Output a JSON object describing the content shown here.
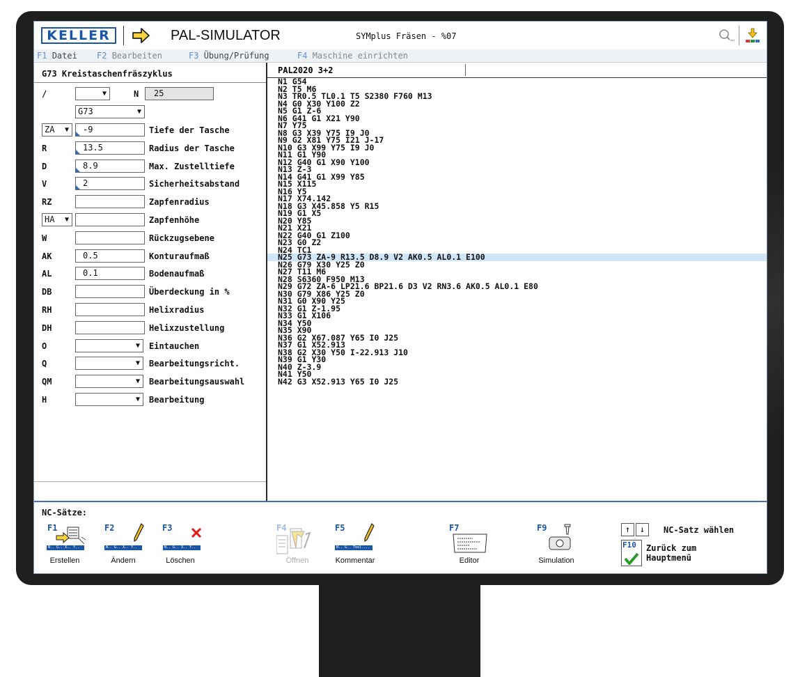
{
  "titlebar": {
    "logo": "KELLER",
    "app_title": "PAL-SIMULATOR",
    "program_title": "SYMplus Fräsen - %07",
    "icons": [
      "arrow-right-icon",
      "search-icon",
      "tool-icon"
    ]
  },
  "menu": [
    {
      "key": "F1",
      "label": "Datei"
    },
    {
      "key": "F2",
      "label": "Bearbeiten"
    },
    {
      "key": "F3",
      "label": "Übung/Prüfung"
    },
    {
      "key": "F4",
      "label": "Maschine einrichten"
    }
  ],
  "left_panel": {
    "title": "G73 Kreistaschenfräszyklus",
    "row_slash": {
      "label": "/",
      "n_label": "N",
      "n_value": "25"
    },
    "g_select": "G73",
    "params": [
      {
        "name": "ZA",
        "value": "-9",
        "desc": "Tiefe der Tasche"
      },
      {
        "name": "R",
        "value": "13.5",
        "desc": "Radius der Tasche"
      },
      {
        "name": "D",
        "value": "8.9",
        "desc": "Max. Zustelltiefe"
      },
      {
        "name": "V",
        "value": "2",
        "desc": "Sicherheitsabstand"
      },
      {
        "name": "RZ",
        "value": "",
        "desc": "Zapfenradius"
      },
      {
        "name": "HA",
        "value": "",
        "desc": "Zapfenhöhe"
      },
      {
        "name": "W",
        "value": "",
        "desc": "Rückzugsebene"
      },
      {
        "name": "AK",
        "value": "0.5",
        "desc": "Konturaufmaß"
      },
      {
        "name": "AL",
        "value": "0.1",
        "desc": "Bodenaufmaß"
      },
      {
        "name": "DB",
        "value": "",
        "desc": "Überdeckung in %"
      },
      {
        "name": "RH",
        "value": "",
        "desc": "Helixradius"
      },
      {
        "name": "DH",
        "value": "",
        "desc": "Helixzustellung"
      },
      {
        "name": "O",
        "value": "",
        "desc": "Eintauchen"
      },
      {
        "name": "Q",
        "value": "",
        "desc": "Bearbeitungsricht."
      },
      {
        "name": "QM",
        "value": "",
        "desc": "Bearbeitungsauswahl"
      },
      {
        "name": "H",
        "value": "",
        "desc": "Bearbeitung"
      }
    ]
  },
  "code": {
    "title": "PAL2020 3+2",
    "highlight_index": 24,
    "lines": [
      "N1 G54",
      "N2 T5 M6",
      "N3 TR0.5 TL0.1 T5 S2380 F760 M13",
      "N4 G0 X30 Y100 Z2",
      "N5 G1 Z-6",
      "N6 G41 G1 X21 Y90",
      "N7 Y75",
      "N8 G3 X39 Y75 I9 J0",
      "N9 G2 X81 Y75 I21 J-17",
      "N10 G3 X99 Y75 I9 J0",
      "N11 G1 Y90",
      "N12 G40 G1 X90 Y100",
      "N13 Z-3",
      "N14 G41 G1 X99 Y85",
      "N15 X115",
      "N16 Y5",
      "N17 X74.142",
      "N18 G3 X45.858 Y5 R15",
      "N19 G1 X5",
      "N20 Y85",
      "N21 X21",
      "N22 G40 G1 Z100",
      "N23 G0 Z2",
      "N24 TC1",
      "N25 G73 ZA-9 R13.5 D8.9 V2 AK0.5 AL0.1 E100",
      "N26 G79 X30 Y25 Z0",
      "N27 T11 M6",
      "N28 S6360 F950 M13",
      "N29 G72 ZA-6 LP21.6 BP21.6 D3 V2 RN3.6 AK0.5 AL0.1 E80",
      "N30 G79 X86 Y25 Z0",
      "N31 G0 X90 Y25",
      "N32 G1 Z-1.95",
      "N33 G1 X106",
      "N34 Y50",
      "N35 X90",
      "N36 G2 X67.087 Y65 I0 J25",
      "N37 G1 X52.913",
      "N38 G2 X30 Y50 I-22.913 J10",
      "N39 G1 Y30",
      "N40 Z-3.9",
      "N41 Y50",
      "N42 G3 X52.913 Y65 I0 J25"
    ]
  },
  "bottom": {
    "title": "NC-Sätze:",
    "tag_small": "N.. G.. X.. Y..",
    "tag_tool": "N.. G.. Tool....",
    "fkeys": [
      {
        "key": "F1",
        "label": "Erstellen"
      },
      {
        "key": "F2",
        "label": "Ändern"
      },
      {
        "key": "F3",
        "label": "Löschen"
      },
      {
        "key": "F4",
        "label": "Öffnen"
      },
      {
        "key": "F5",
        "label": "Kommentar"
      },
      {
        "key": "F7",
        "label": "Editor"
      },
      {
        "key": "F9",
        "label": "Simulation"
      }
    ],
    "nav_up": "↑",
    "nav_down": "↓",
    "nav_text": "NC-Satz wählen",
    "f10_key": "F10",
    "f10_line1": "Zurück zum",
    "f10_line2": "Hauptmenü"
  }
}
